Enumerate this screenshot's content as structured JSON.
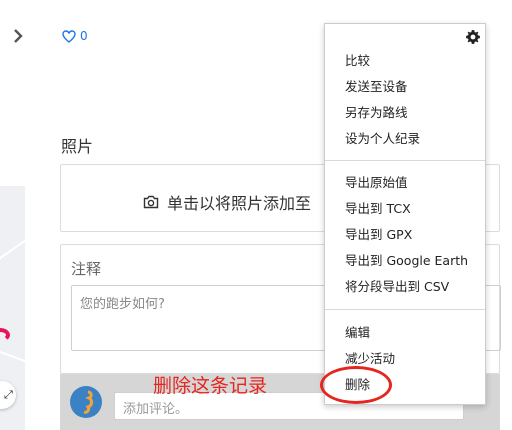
{
  "like": {
    "count": "0"
  },
  "photos": {
    "title": "照片",
    "add_label": "单击以将照片添加至"
  },
  "notes": {
    "label": "注释",
    "placeholder": "您的跑步如何?"
  },
  "comment": {
    "placeholder": "添加评论。"
  },
  "menu": {
    "groups": [
      [
        "比较",
        "发送至设备",
        "另存为路线",
        "设为个人纪录"
      ],
      [
        "导出原始值",
        "导出到 TCX",
        "导出到 GPX",
        "导出到 Google Earth",
        "将分段导出到 CSV"
      ],
      [
        "编辑",
        "减少活动",
        "删除"
      ]
    ]
  },
  "annotation": {
    "text": "删除这条记录",
    "color": "#e5261f"
  },
  "colors": {
    "accent": "#1a73e8",
    "route": "#e8145a"
  },
  "icons": {
    "chevron": "chevron-right-icon",
    "like": "heart-icon",
    "camera": "camera-icon",
    "gear": "gear-icon"
  }
}
